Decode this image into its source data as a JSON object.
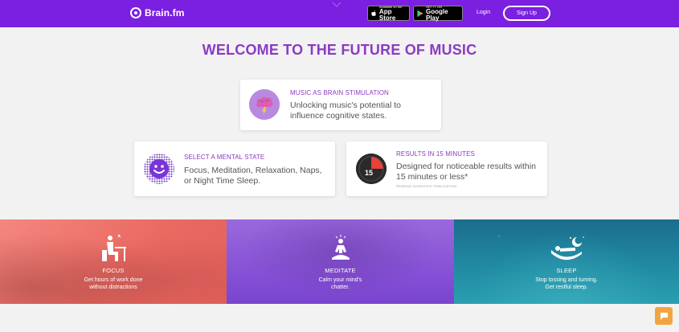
{
  "header": {
    "logo_text": "Brain.fm",
    "app_store": {
      "small": "Available on the",
      "big": "App Store"
    },
    "google_play": {
      "small": "GET IT ON",
      "big": "Google Play"
    },
    "login_label": "Login",
    "signup_label": "Sign Up",
    "bg_color": "#7b1fe0"
  },
  "title": "WELCOME TO THE FUTURE OF MUSIC",
  "cards": [
    {
      "heading": "MUSIC AS BRAIN STIMULATION",
      "body": "Unlocking music's potential to influence cognitive states.",
      "icon": "brain-lightning-icon"
    },
    {
      "heading": "SELECT A MENTAL STATE",
      "body": "Focus, Meditation, Relaxation, Naps, or Night Time Sleep.",
      "icon": "smiley-face-icon"
    },
    {
      "heading": "RESULTS IN 15 MINUTES",
      "body": "Designed for noticeable results within 15 minutes or less*",
      "fine_print": "PENDING SCIENTIFIC PUBLICATION",
      "icon": "timer-icon",
      "timer_value": "15"
    }
  ],
  "banners": [
    {
      "label": "FOCUS",
      "line1": "Get hours of work done",
      "line2": "without distractions",
      "icon": "person-at-desk-icon",
      "color": "#ea6a62"
    },
    {
      "label": "MEDITATE",
      "line1": "Calm your mind's",
      "line2": "chatter.",
      "icon": "meditating-person-icon",
      "color": "#8752d6"
    },
    {
      "label": "SLEEP",
      "line1": "Stop tossing and turning.",
      "line2": "Get restful sleep.",
      "icon": "sleeping-person-moon-icon",
      "color": "#1f87a1"
    }
  ],
  "chat_icon": "chat-bubble-icon"
}
